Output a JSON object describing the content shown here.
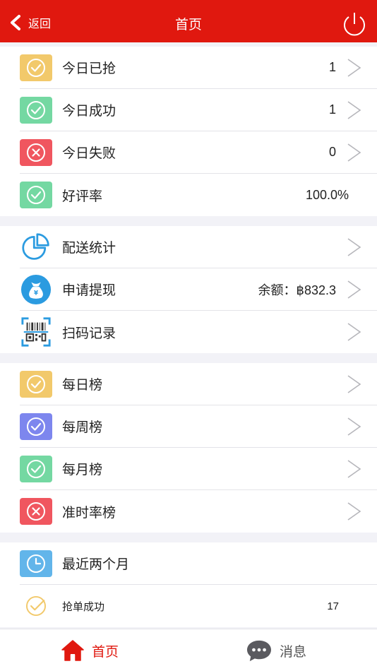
{
  "nav": {
    "back_label": "返回",
    "title": "首页",
    "back_icon": "chevron-left-icon",
    "power_icon": "power-icon"
  },
  "today": [
    {
      "label": "今日已抢",
      "value": "1",
      "color": "#f2c96b",
      "icon": "check-circle-icon"
    },
    {
      "label": "今日成功",
      "value": "1",
      "color": "#74d8a2",
      "icon": "check-circle-icon"
    },
    {
      "label": "今日失败",
      "value": "0",
      "color": "#f0565f",
      "icon": "x-circle-icon"
    },
    {
      "label": "好评率",
      "value": "100.0%",
      "color": "#74d8a2",
      "icon": "check-circle-icon"
    }
  ],
  "tools": [
    {
      "label": "配送统计",
      "value": "",
      "icon": "pie-chart-icon"
    },
    {
      "label": "申请提现",
      "value": "余额：฿832.3",
      "icon": "money-bag-icon"
    },
    {
      "label": "扫码记录",
      "value": "",
      "icon": "qr-scan-icon"
    }
  ],
  "rankings": [
    {
      "label": "每日榜",
      "color": "#f2c96b",
      "icon": "check-circle-icon"
    },
    {
      "label": "每周榜",
      "color": "#7d86ee",
      "icon": "check-circle-icon"
    },
    {
      "label": "每月榜",
      "color": "#74d8a2",
      "icon": "check-circle-icon"
    },
    {
      "label": "准时率榜",
      "color": "#f0565f",
      "icon": "x-circle-icon"
    }
  ],
  "recent": {
    "header": "最近两个月",
    "header_icon": "clock-icon",
    "items": [
      {
        "label": "抢单成功",
        "value": "17",
        "icon": "check-circle-icon"
      }
    ]
  },
  "tabbar": {
    "home_label": "首页",
    "message_label": "消息",
    "home_icon": "home-icon",
    "message_icon": "chat-bubble-icon"
  },
  "colors": {
    "brand": "#e0180f",
    "background": "#f2f2f7"
  }
}
